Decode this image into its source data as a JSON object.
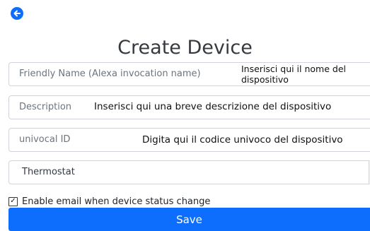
{
  "page": {
    "title": "Create Device",
    "back_icon": "arrow-left-circle-icon",
    "accent_color": "#0d6efd"
  },
  "form": {
    "friendly_name": {
      "placeholder": "Friendly Name (Alexa invocation name)",
      "annotation_line1": "Inserisci qui il nome del",
      "annotation_line2": "dispositivo"
    },
    "description": {
      "placeholder": "Description",
      "annotation": "Inserisci qui una breve descrizione del dispositivo"
    },
    "unique_id": {
      "placeholder": "univocal ID",
      "annotation": "Digita qui il codice univoco del dispositivo"
    },
    "device_type": {
      "selected": "Thermostat",
      "arrow_icon": "chevron-down-icon"
    },
    "email_notification": {
      "checked": true,
      "label": "Enable email when device status change"
    },
    "save_label": "Save"
  }
}
